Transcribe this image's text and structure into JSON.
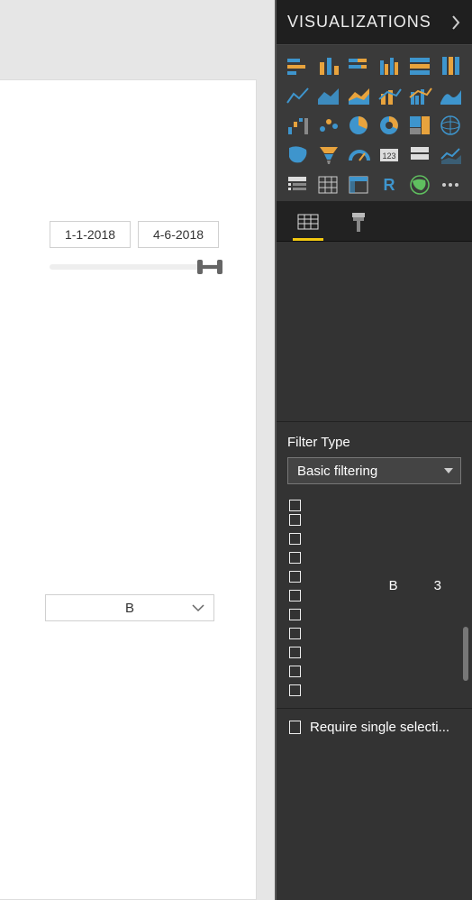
{
  "pane": {
    "title": "VISUALIZATIONS"
  },
  "canvas": {
    "date_slicer": {
      "start": "1-1-2018",
      "end": "4-6-2018"
    },
    "dropdown_slicer": {
      "value": "B"
    }
  },
  "viz_icons": [
    "stacked-bar-icon",
    "stacked-column-icon",
    "clustered-bar-icon",
    "clustered-column-icon",
    "hundred-stacked-bar-icon",
    "hundred-stacked-column-icon",
    "line-chart-icon",
    "area-chart-icon",
    "stacked-area-icon",
    "line-stacked-column-icon",
    "line-clustered-column-icon",
    "ribbon-chart-icon",
    "waterfall-icon",
    "scatter-icon",
    "pie-icon",
    "donut-icon",
    "treemap-icon",
    "map-icon",
    "filled-map-icon",
    "funnel-icon",
    "gauge-icon",
    "card-icon",
    "multi-row-card-icon",
    "kpi-icon",
    "slicer-icon",
    "table-icon",
    "matrix-icon",
    "r-visual-icon",
    "arcgis-icon",
    "more-visuals-icon"
  ],
  "filter": {
    "type_label": "Filter Type",
    "type_value": "Basic filtering",
    "highlight": {
      "label": "B",
      "count": "3"
    },
    "checkbox_count": 11,
    "require_single_label": "Require single selecti..."
  },
  "colors": {
    "accent": "#f2c811",
    "blue": "#3e95cd",
    "orange": "#e8a33d"
  }
}
